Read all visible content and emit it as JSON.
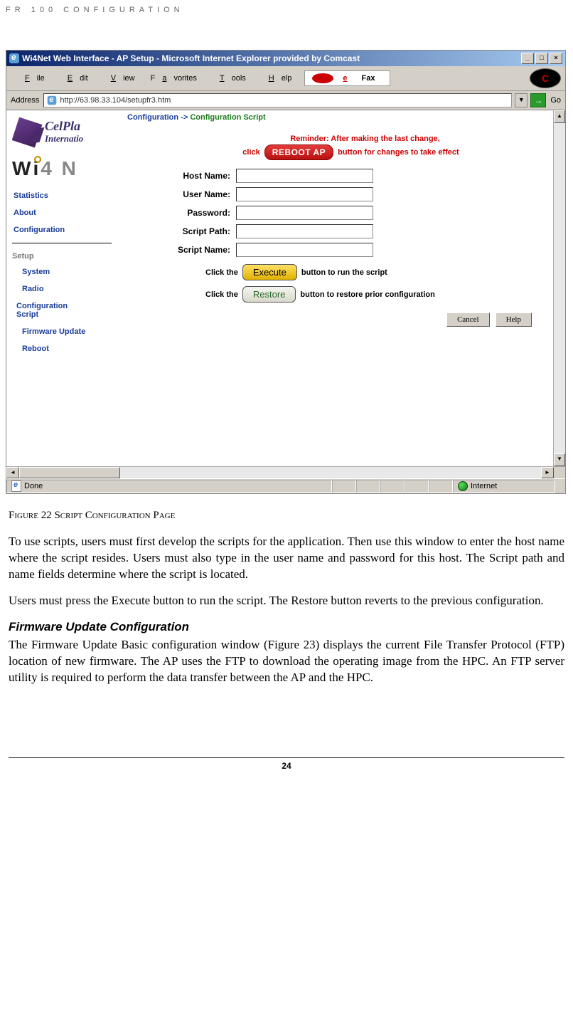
{
  "header": "FR 100 CONFIGURATION",
  "window": {
    "title": "Wi4Net Web Interface - AP Setup - Microsoft Internet Explorer provided by Comcast",
    "menus": [
      "File",
      "Edit",
      "View",
      "Favorites",
      "Tools",
      "Help"
    ],
    "efax_e": "e",
    "efax_fax": "Fax",
    "addr_label": "Address",
    "url": "http://63.98.33.104/setupfr3.htm",
    "go": "Go",
    "status_left": "Done",
    "status_zone": "Internet"
  },
  "sidebar": {
    "brand1": "CelPla",
    "brand1sub": "Internatio",
    "brand2a": "W",
    "brand2b": "4 N",
    "nav": {
      "statistics": "Statistics",
      "about": "About",
      "configuration": "Configuration",
      "setup": "Setup",
      "system": "System",
      "radio": "Radio",
      "cfgscript": "Configuration Script",
      "firmware": "Firmware Update",
      "reboot": "Reboot"
    }
  },
  "main": {
    "bc1": "Configuration ->",
    "bc2": "Configuration Script",
    "reminder_top": "Reminder: After making the last change,",
    "reminder_click": "click",
    "reboot_btn": "REBOOT AP",
    "reminder_tail": "button for changes to take effect",
    "labels": {
      "host": "Host Name:",
      "user": "User Name:",
      "pass": "Password:",
      "spath": "Script Path:",
      "sname": "Script Name:"
    },
    "exec_pre": "Click the",
    "exec_btn": "Execute",
    "exec_post": "button to run the script",
    "restore_pre": "Click the",
    "restore_btn": "Restore",
    "restore_post": "button to restore prior configuration",
    "cancel": "Cancel",
    "help": "Help"
  },
  "doc": {
    "caption": "Figure 22 Script Configuration Page",
    "p1": "To use scripts, users must first develop the scripts for the application. Then use this window to enter the host name where the script resides. Users must also type in the user name and password for this host. The Script path and name fields determine where the script is located.",
    "p2": "Users must press the Execute button to run the script. The Restore button reverts to the previous configuration.",
    "h2": "Firmware Update Configuration",
    "p3": "The Firmware Update Basic configuration window (Figure 23) displays the current File Transfer Protocol (FTP) location of new firmware. The AP uses the FTP to download the operating image from the HPC. An FTP server utility is required to perform the data transfer between the AP and the HPC."
  },
  "page_number": "24"
}
